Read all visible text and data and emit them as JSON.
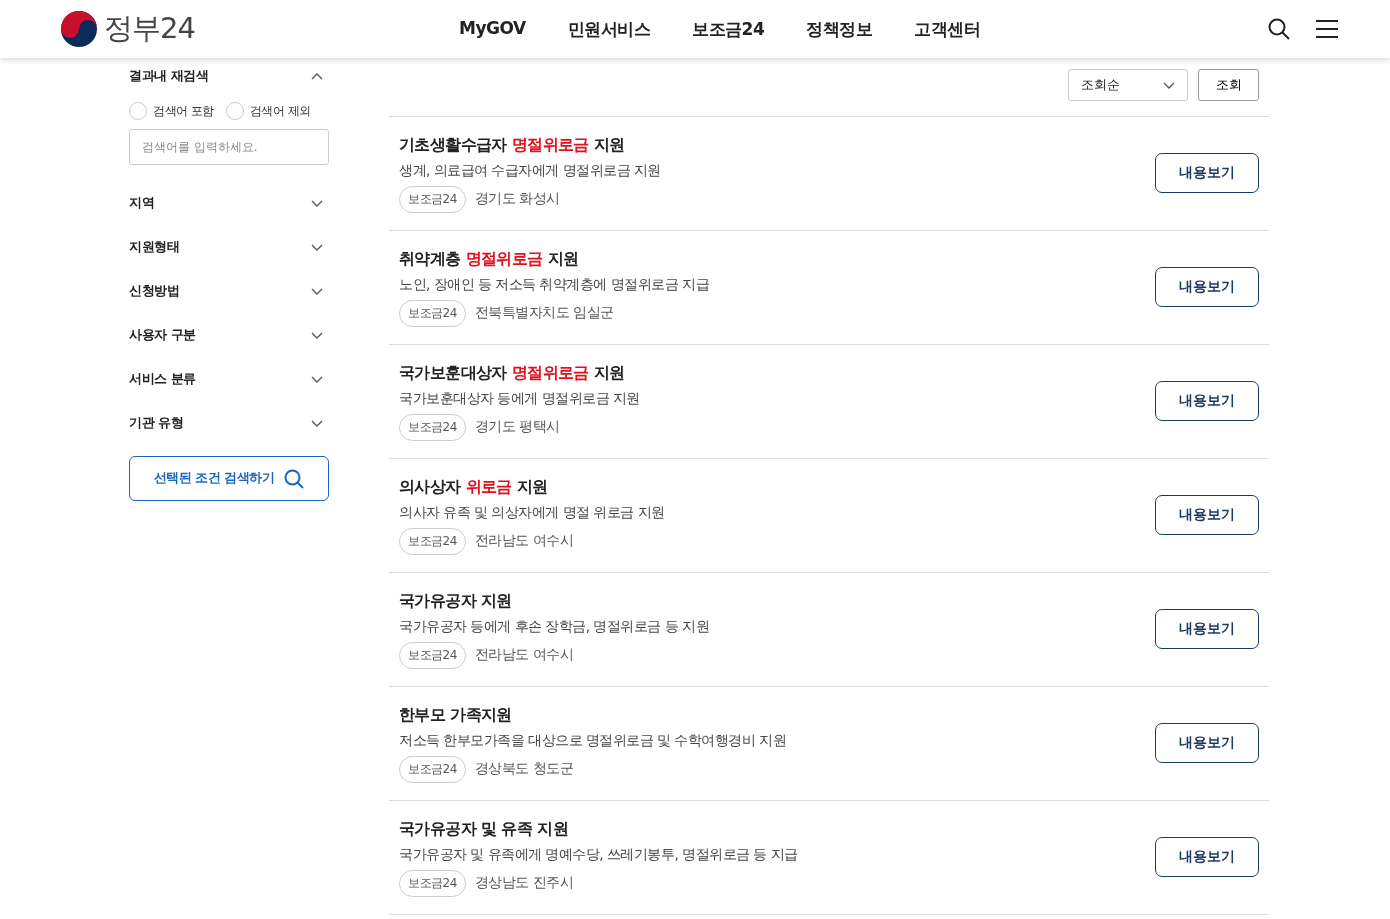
{
  "header": {
    "logo_text": "정부24",
    "nav": [
      "MyGOV",
      "민원서비스",
      "보조금24",
      "정책정보",
      "고객센터"
    ]
  },
  "sidebar": {
    "refine": {
      "title": "결과내 재검색",
      "expanded": true,
      "options": [
        {
          "label": "검색어 포함",
          "selected": false
        },
        {
          "label": "검색어 제외",
          "selected": false
        }
      ],
      "search": {
        "placeholder": "검색어를 입력하세요."
      }
    },
    "filters": [
      {
        "label": "지역",
        "expanded": false
      },
      {
        "label": "지원형태",
        "expanded": false
      },
      {
        "label": "신청방법",
        "expanded": false
      },
      {
        "label": "사용자 구분",
        "expanded": false
      },
      {
        "label": "서비스 분류",
        "expanded": false
      },
      {
        "label": "기관 유형",
        "expanded": false
      }
    ],
    "search_button": "선택된 조건 검색하기"
  },
  "toolbar": {
    "sort": "조회순",
    "button": "조회"
  },
  "results": [
    {
      "title": [
        {
          "text": "기초생활수급자 ",
          "highlight": false
        },
        {
          "text": "명절위로금",
          "highlight": true
        },
        {
          "text": " 지원",
          "highlight": false
        }
      ],
      "description": "생계, 의료급여 수급자에게 명절위로금 지원",
      "tag": "보조금24",
      "region": "경기도 화성시",
      "button": "내용보기"
    },
    {
      "title": [
        {
          "text": "취약계층 ",
          "highlight": false
        },
        {
          "text": "명절위로금",
          "highlight": true
        },
        {
          "text": " 지원",
          "highlight": false
        }
      ],
      "description": "노인, 장애인 등 저소득 취약계층에 명절위로금 지급",
      "tag": "보조금24",
      "region": "전북특별자치도 임실군",
      "button": "내용보기"
    },
    {
      "title": [
        {
          "text": "국가보훈대상자 ",
          "highlight": false
        },
        {
          "text": "명절위로금",
          "highlight": true
        },
        {
          "text": " 지원",
          "highlight": false
        }
      ],
      "description": "국가보훈대상자 등에게 명절위로금 지원",
      "tag": "보조금24",
      "region": "경기도 평택시",
      "button": "내용보기"
    },
    {
      "title": [
        {
          "text": "의사상자 ",
          "highlight": false
        },
        {
          "text": "위로금",
          "highlight": true
        },
        {
          "text": " 지원",
          "highlight": false
        }
      ],
      "description": "의사자 유족 및 의상자에게 명절 위로금 지원",
      "tag": "보조금24",
      "region": "전라남도 여수시",
      "button": "내용보기"
    },
    {
      "title": [
        {
          "text": "국가유공자 지원",
          "highlight": false
        }
      ],
      "description": "국가유공자 등에게 후손 장학금, 명절위로금 등 지원",
      "tag": "보조금24",
      "region": "전라남도 여수시",
      "button": "내용보기"
    },
    {
      "title": [
        {
          "text": "한부모 가족지원",
          "highlight": false
        }
      ],
      "description": "저소득 한부모가족을 대상으로 명절위로금 및 수학여행경비 지원",
      "tag": "보조금24",
      "region": "경상북도 청도군",
      "button": "내용보기"
    },
    {
      "title": [
        {
          "text": "국가유공자 및 유족 지원",
          "highlight": false
        }
      ],
      "description": "국가유공자 및 유족에게 명예수당, 쓰레기봉투, 명절위로금 등 지급",
      "tag": "보조금24",
      "region": "경상남도 진주시",
      "button": "내용보기"
    }
  ]
}
